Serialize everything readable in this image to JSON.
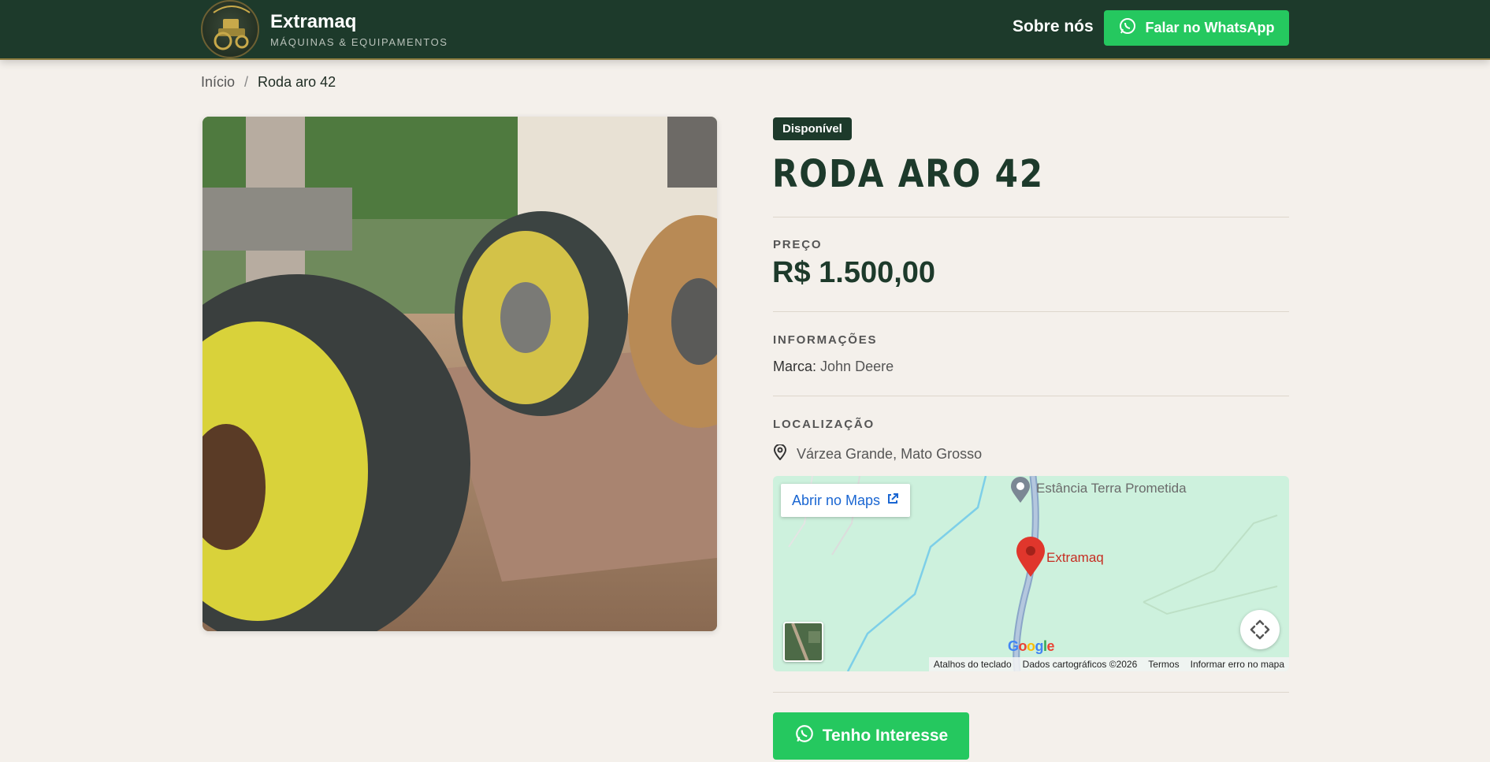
{
  "colors": {
    "header_bg": "#1d3a2b",
    "accent_green": "#25c85f",
    "page_bg": "#f4f0eb"
  },
  "header": {
    "brand_name": "Extramaq",
    "brand_subtitle": "MÁQUINAS & EQUIPAMENTOS",
    "nav_about": "Sobre nós",
    "whatsapp_button": "Falar no WhatsApp",
    "logo_icon": "tractor-logo",
    "whatsapp_icon": "whatsapp-icon"
  },
  "breadcrumb": {
    "home": "Início",
    "separator": "/",
    "current": "Roda aro 42"
  },
  "product": {
    "status_badge": "Disponível",
    "title": "RODA ARO 42",
    "price_label": "PREÇO",
    "price": "R$ 1.500,00",
    "info_label": "INFORMAÇÕES",
    "brand_key": "Marca:",
    "brand_value": "John Deere",
    "location_label": "LOCALIZAÇÃO",
    "location": "Várzea Grande, Mato Grosso",
    "interest_button": "Tenho Interesse"
  },
  "map": {
    "open_in_maps": "Abrir no Maps",
    "poi_label": "Estância Terra Prometida",
    "place_label": "Extramaq",
    "google_logo": "Google",
    "footer": {
      "shortcuts": "Atalhos do teclado",
      "map_data": "Dados cartográficos ©2026",
      "terms": "Termos",
      "report": "Informar erro no mapa"
    }
  }
}
